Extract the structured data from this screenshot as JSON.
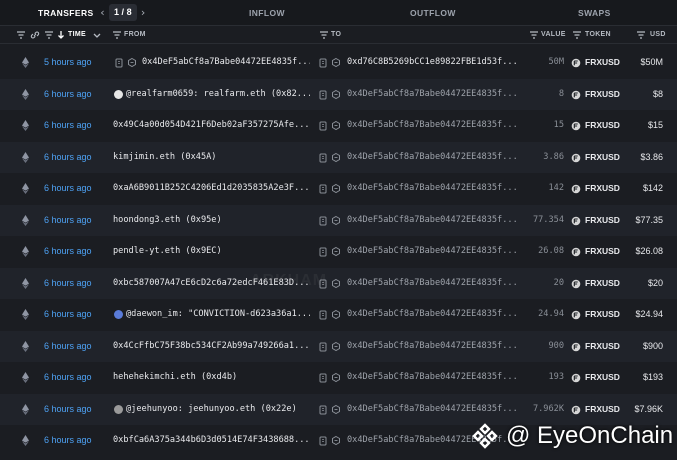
{
  "tabs": {
    "transfers": "TRANSFERS",
    "inflow": "INFLOW",
    "outflow": "OUTFLOW",
    "swaps": "SWAPS",
    "page_current": "1",
    "page_sep": "/",
    "page_total": "8",
    "prev": "‹",
    "next": "›"
  },
  "columns": {
    "time": "TIME",
    "from": "FROM",
    "to": "TO",
    "value": "VALUE",
    "token": "TOKEN",
    "usd": "USD"
  },
  "colors": {
    "accent": "#4ea2f4",
    "bg": "#1b1d22",
    "row_alt": "#20232a"
  },
  "rows": [
    {
      "time": "5 hours ago",
      "from": "0x4DeF5abCf8a7Babe04472EE4835f...",
      "to": "0xd76C8B5269bCC1e89822FBE1d53f...",
      "value": "50M",
      "token": "FRXUSD",
      "usd": "$50M"
    },
    {
      "time": "6 hours ago",
      "from": "@realfarm0659: realfarm.eth (0x82...",
      "to": "0x4DeF5abCf8a7Babe04472EE4835f...",
      "value": "8",
      "token": "FRXUSD",
      "usd": "$8"
    },
    {
      "time": "6 hours ago",
      "from": "0x49C4a00d054D421F6Deb02aF357275Afe...",
      "to": "0x4DeF5abCf8a7Babe04472EE4835f...",
      "value": "15",
      "token": "FRXUSD",
      "usd": "$15"
    },
    {
      "time": "6 hours ago",
      "from": "kimjimin.eth (0x45A)",
      "to": "0x4DeF5abCf8a7Babe04472EE4835f...",
      "value": "3.86",
      "token": "FRXUSD",
      "usd": "$3.86"
    },
    {
      "time": "6 hours ago",
      "from": "0xaA6B9011B252C4206Ed1d2035835A2e3F...",
      "to": "0x4DeF5abCf8a7Babe04472EE4835f...",
      "value": "142",
      "token": "FRXUSD",
      "usd": "$142"
    },
    {
      "time": "6 hours ago",
      "from": "hoondong3.eth (0x95e)",
      "to": "0x4DeF5abCf8a7Babe04472EE4835f...",
      "value": "77.354",
      "token": "FRXUSD",
      "usd": "$77.35"
    },
    {
      "time": "6 hours ago",
      "from": "pendle-yt.eth (0x9EC)",
      "to": "0x4DeF5abCf8a7Babe04472EE4835f...",
      "value": "26.08",
      "token": "FRXUSD",
      "usd": "$26.08"
    },
    {
      "time": "6 hours ago",
      "from": "0xbc587007A47cE6cD2c6a72edcF461E83D...",
      "to": "0x4DeF5abCf8a7Babe04472EE4835f...",
      "value": "20",
      "token": "FRXUSD",
      "usd": "$20"
    },
    {
      "time": "6 hours ago",
      "from": "@daewon_im: \"CONVICTION-d623a36a1...",
      "to": "0x4DeF5abCf8a7Babe04472EE4835f...",
      "value": "24.94",
      "token": "FRXUSD",
      "usd": "$24.94"
    },
    {
      "time": "6 hours ago",
      "from": "0x4CcFfbC75F38bc534CF2Ab99a749266a1...",
      "to": "0x4DeF5abCf8a7Babe04472EE4835f...",
      "value": "900",
      "token": "FRXUSD",
      "usd": "$900"
    },
    {
      "time": "6 hours ago",
      "from": "hehehekimchi.eth (0xd4b)",
      "to": "0x4DeF5abCf8a7Babe04472EE4835f...",
      "value": "193",
      "token": "FRXUSD",
      "usd": "$193"
    },
    {
      "time": "6 hours ago",
      "from": "@jeehunyoo: jeehunyoo.eth (0x22e)",
      "to": "0x4DeF5abCf8a7Babe04472EE4835f...",
      "value": "7.962K",
      "token": "FRXUSD",
      "usd": "$7.96K"
    },
    {
      "time": "6 hours ago",
      "from": "0xbfCa6A375a344b6D3d0514E74F3438688...",
      "to": "0x4DeF5abCf8a7Babe04472EE4835f...",
      "value": "",
      "token": "",
      "usd": ""
    }
  ],
  "watermark": "ARKHAM",
  "badge": "@ EyeOnChain"
}
